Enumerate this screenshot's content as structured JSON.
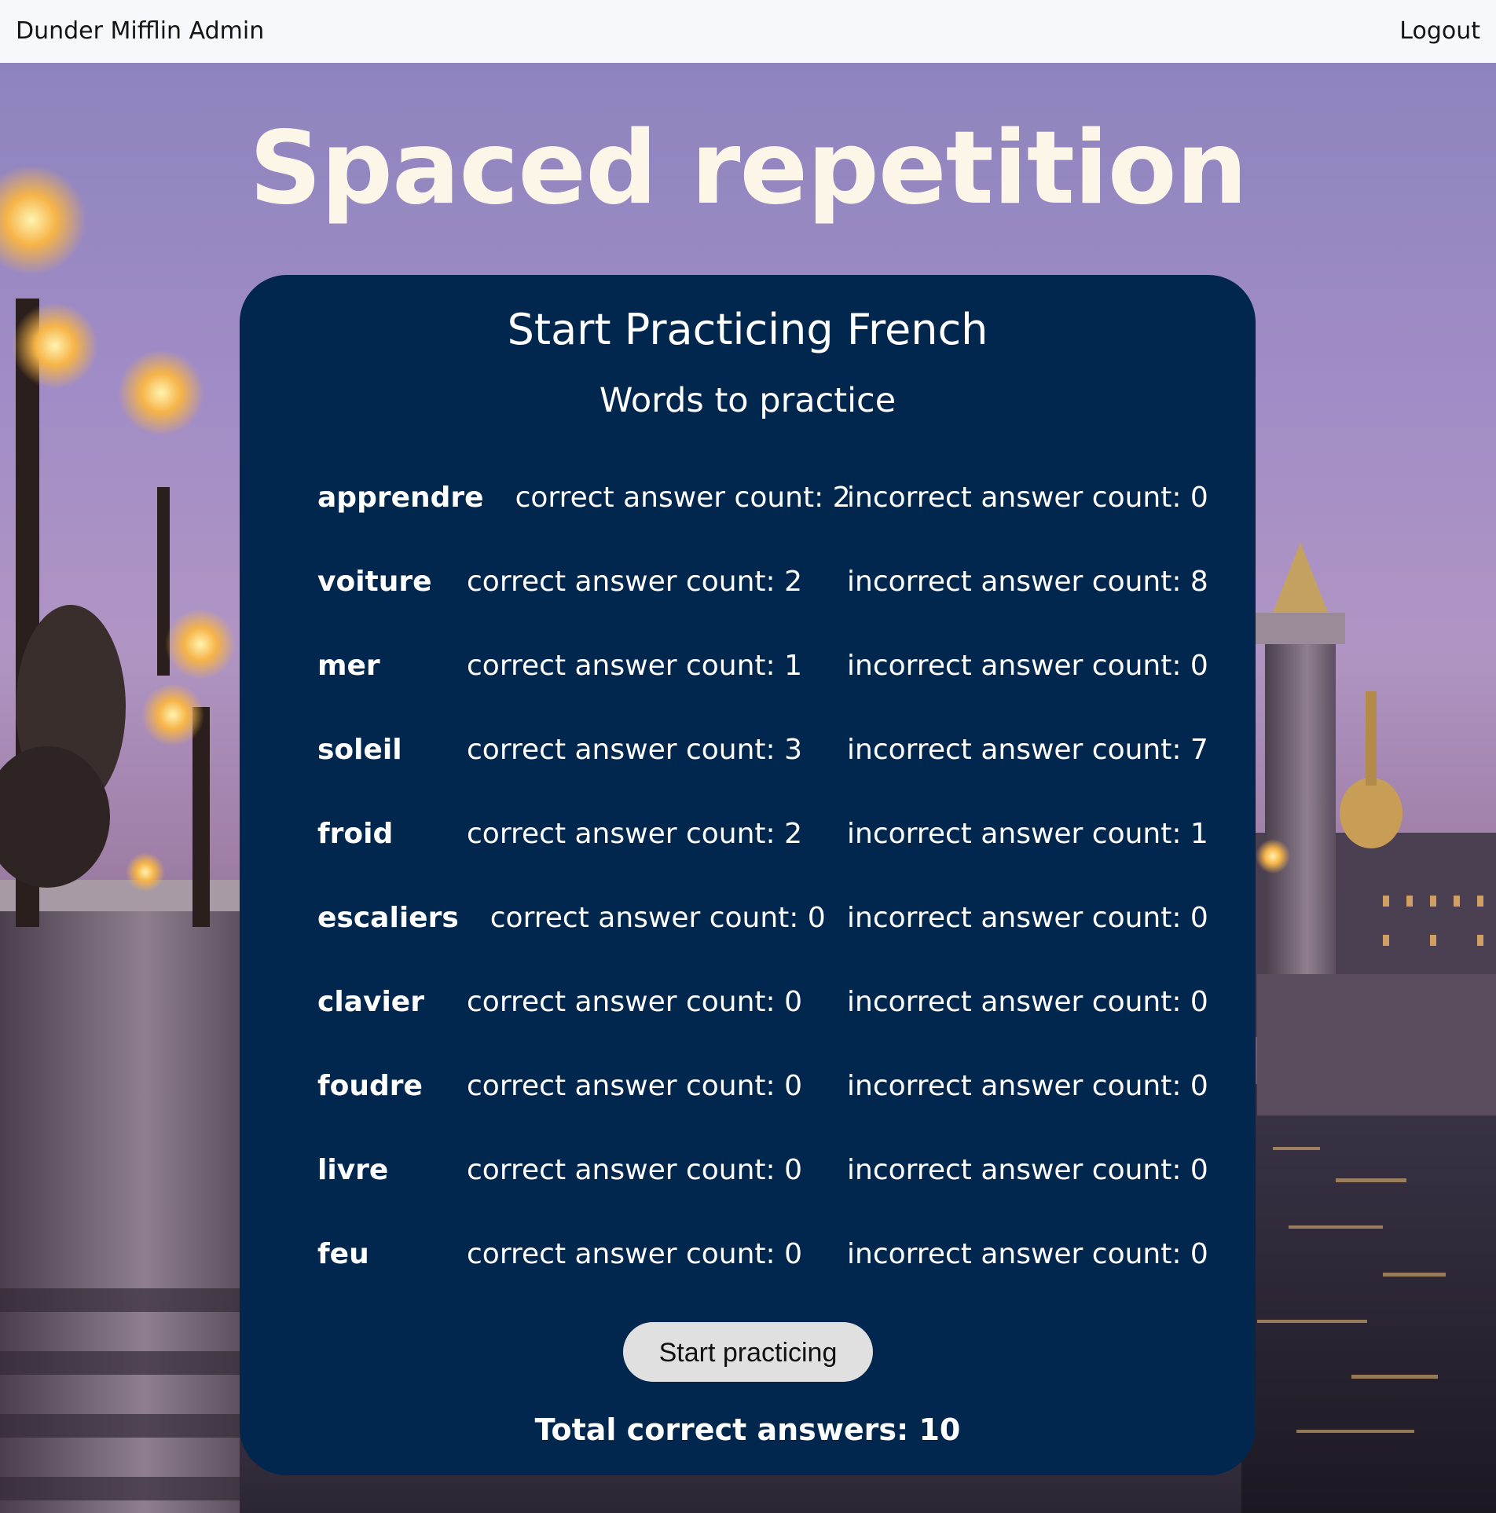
{
  "nav": {
    "brand": "Dunder Mifflin Admin",
    "logout_label": "Logout"
  },
  "page": {
    "title": "Spaced repetition"
  },
  "card": {
    "title": "Start Practicing French",
    "subtitle": "Words to practice",
    "words": [
      {
        "word": "apprendre",
        "correct": "correct answer count: 2",
        "incorrect": "incorrect answer count: 0"
      },
      {
        "word": "voiture",
        "correct": "correct answer count: 2",
        "incorrect": "incorrect answer count: 8"
      },
      {
        "word": "mer",
        "correct": "correct answer count: 1",
        "incorrect": "incorrect answer count: 0"
      },
      {
        "word": "soleil",
        "correct": "correct answer count: 3",
        "incorrect": "incorrect answer count: 7"
      },
      {
        "word": "froid",
        "correct": "correct answer count: 2",
        "incorrect": "incorrect answer count: 1"
      },
      {
        "word": "escaliers",
        "correct": "correct answer count: 0",
        "incorrect": "incorrect answer count: 0"
      },
      {
        "word": "clavier",
        "correct": "correct answer count: 0",
        "incorrect": "incorrect answer count: 0"
      },
      {
        "word": "foudre",
        "correct": "correct answer count: 0",
        "incorrect": "incorrect answer count: 0"
      },
      {
        "word": "livre",
        "correct": "correct answer count: 0",
        "incorrect": "incorrect answer count: 0"
      },
      {
        "word": "feu",
        "correct": "correct answer count: 0",
        "incorrect": "incorrect answer count: 0"
      }
    ],
    "start_button_label": "Start practicing",
    "total_label": "Total correct answers: 10"
  },
  "colors": {
    "card_background": "#02274f",
    "title_color": "#fbf6e8",
    "navbar_background": "#f7f8fc",
    "button_background": "#e0e0e0"
  }
}
